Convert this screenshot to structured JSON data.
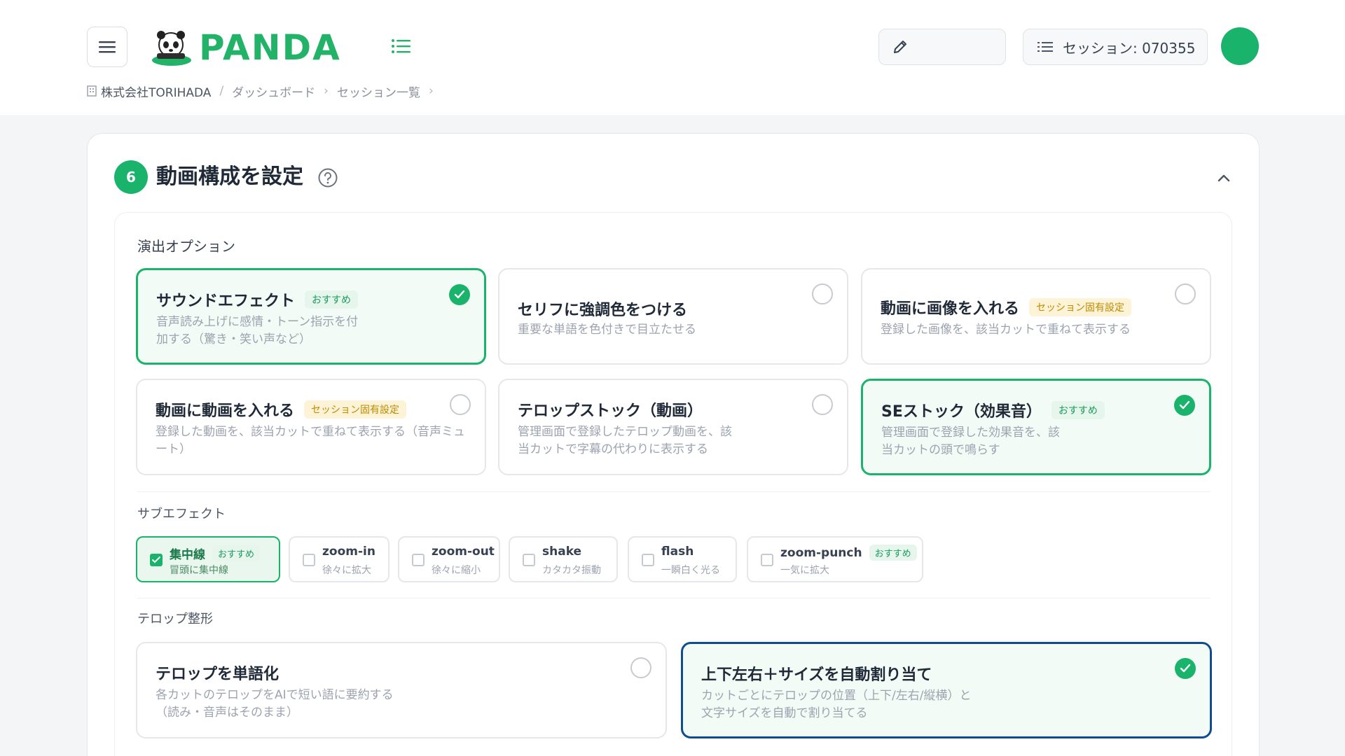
{
  "header": {
    "brand": "PANDA",
    "session_label": "セッション: 070355",
    "edit_value": ""
  },
  "breadcrumb": {
    "org": "株式会社TORIHADA",
    "items": [
      "ダッシュボード",
      "セッション一覧"
    ]
  },
  "panel": {
    "step": "6",
    "title": "動画構成を設定"
  },
  "effects_section": {
    "label": "演出オプション",
    "cards": [
      {
        "title": "サウンドエフェクト",
        "badge": "おすすめ",
        "desc": "音声読み上げに感情・トーン指示を付加する（驚き・笑い声など）",
        "selected": true
      },
      {
        "title": "セリフに強調色をつける",
        "badge": "",
        "desc": "重要な単語を色付きで目立たせる",
        "selected": false
      },
      {
        "title": "動画に画像を入れる",
        "badge": "セッション固有設定",
        "desc": "登録した画像を、該当カットで重ねて表示する",
        "selected": false
      },
      {
        "title": "動画に動画を入れる",
        "badge": "セッション固有設定",
        "desc": "登録した動画を、該当カットで重ねて表示する（音声ミュート）",
        "selected": false
      },
      {
        "title": "テロップストック（動画）",
        "badge": "",
        "desc": "管理画面で登録したテロップ動画を、該当カットで字幕の代わりに表示する",
        "selected": false
      },
      {
        "title": "SEストック（効果音）",
        "badge": "おすすめ",
        "desc": "管理画面で登録した効果音を、該当カットの頭で鳴らす",
        "selected": true
      }
    ]
  },
  "sub_effects": {
    "label": "サブエフェクト",
    "chips": [
      {
        "title": "集中線",
        "badge": "おすすめ",
        "sub": "冒頭に集中線",
        "checked": true
      },
      {
        "title": "zoom-in",
        "badge": "",
        "sub": "徐々に拡大",
        "checked": false
      },
      {
        "title": "zoom-out",
        "badge": "",
        "sub": "徐々に縮小",
        "checked": false
      },
      {
        "title": "shake",
        "badge": "",
        "sub": "カタカタ振動",
        "checked": false
      },
      {
        "title": "flash",
        "badge": "",
        "sub": "一瞬白く光る",
        "checked": false
      },
      {
        "title": "zoom-punch",
        "badge": "おすすめ",
        "sub": "一気に拡大",
        "checked": false
      }
    ]
  },
  "telop_section": {
    "label": "テロップ整形",
    "cards": [
      {
        "title": "テロップを単語化",
        "desc_line1": "各カットのテロップをAIで短い語に要約する",
        "desc_line2": "（読み・音声はそのまま）",
        "selected": false
      },
      {
        "title": "上下左右＋サイズを自動割り当て",
        "desc_line1": "カットごとにテロップの位置（上下/左右/縦横）と",
        "desc_line2": "文字サイズを自動で割り当てる",
        "selected": true
      }
    ]
  },
  "colors": {
    "accent": "#19b36b",
    "selected_blue": "#0e4e8c",
    "badge_yellow": "#c08a00"
  }
}
